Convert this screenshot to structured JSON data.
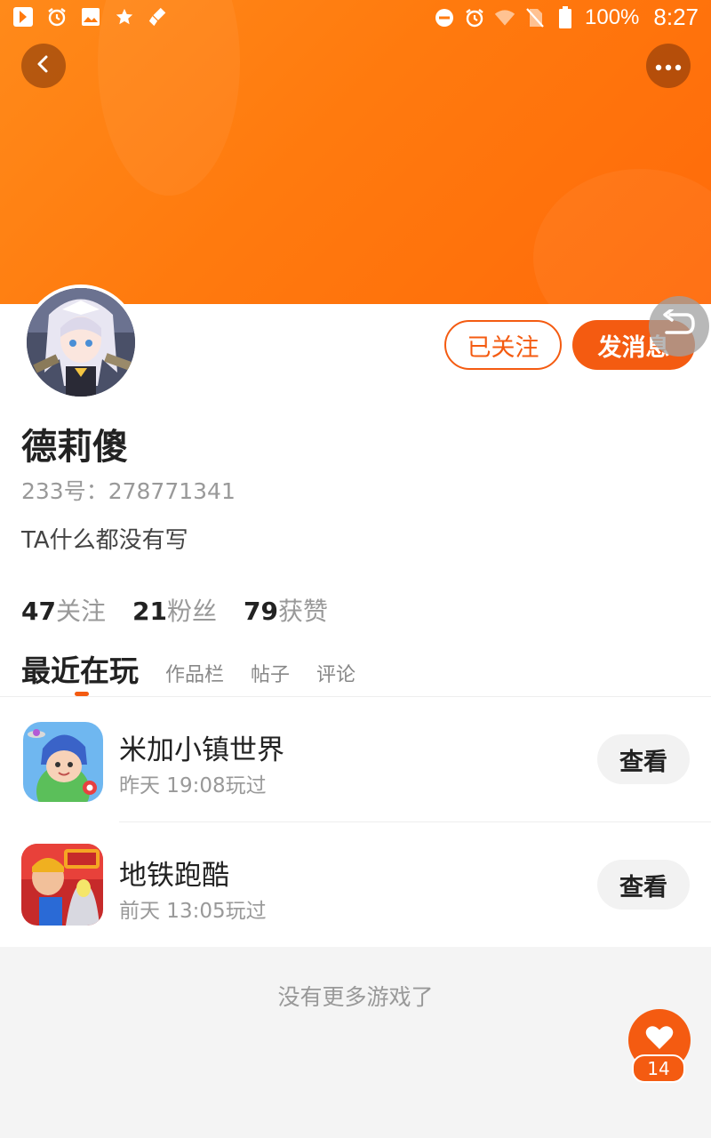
{
  "status_bar": {
    "battery_text": "100%",
    "time": "8:27",
    "left_icons": [
      "app-notification-icon",
      "alarm-icon",
      "image-icon",
      "star-icon",
      "cleaner-icon"
    ],
    "right_icons": [
      "dnd-icon",
      "alarm-icon",
      "wifi-icon",
      "no-sim-icon",
      "battery-icon"
    ]
  },
  "header": {
    "back_icon": "chevron-left-icon",
    "more_icon": "more-dots-icon",
    "colors": {
      "gradient_start": "#ff8a1a",
      "gradient_end": "#ff6a0a"
    }
  },
  "profile": {
    "name": "德莉傻",
    "uid": "233号：278771341",
    "bio": "TA什么都没有写",
    "followed_label": "已关注",
    "message_label": "发消息",
    "stats": [
      {
        "num": "47",
        "label": "关注"
      },
      {
        "num": "21",
        "label": "粉丝"
      },
      {
        "num": "79",
        "label": "获赞"
      }
    ]
  },
  "tabs": {
    "active": "最近在玩",
    "items": [
      "作品栏",
      "帖子",
      "评论"
    ]
  },
  "games": [
    {
      "title": "米加小镇世界",
      "time": "昨天 19:08玩过",
      "button": "查看"
    },
    {
      "title": "地铁跑酷",
      "time": "前天 13:05玩过",
      "button": "查看"
    }
  ],
  "footer": {
    "no_more": "没有更多游戏了",
    "like_count": "14"
  },
  "accent": "#f45b11"
}
